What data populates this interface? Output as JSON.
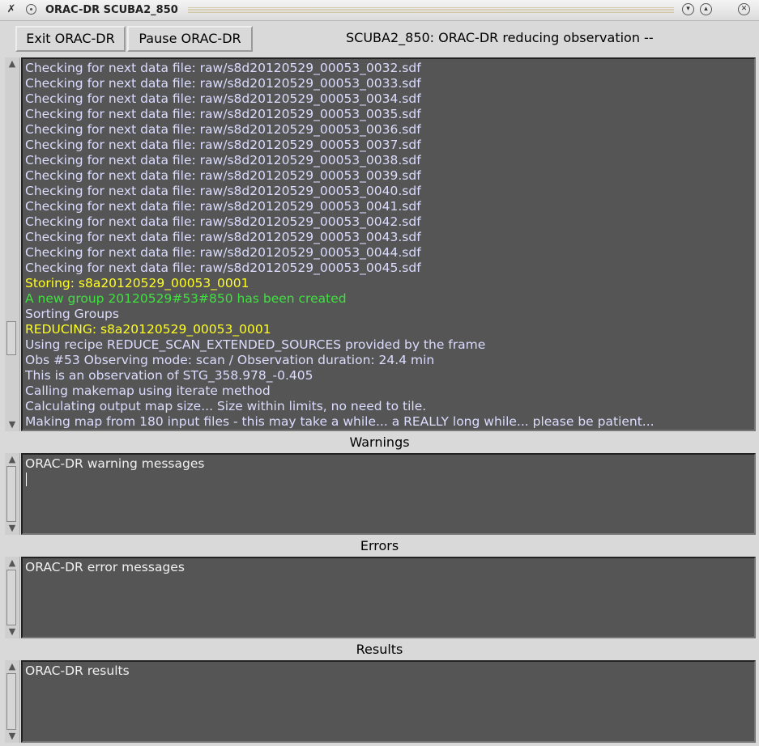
{
  "window": {
    "title": "ORAC-DR SCUBA2_850"
  },
  "toolbar": {
    "exit_label": "Exit ORAC-DR",
    "pause_label": "Pause ORAC-DR",
    "status": "SCUBA2_850: ORAC-DR reducing observation --"
  },
  "log": {
    "lines": [
      {
        "text": "Checking for next data file: raw/s8d20120529_00053_0032.sdf",
        "color": "#dcdcff"
      },
      {
        "text": "Checking for next data file: raw/s8d20120529_00053_0033.sdf",
        "color": "#dcdcff"
      },
      {
        "text": "Checking for next data file: raw/s8d20120529_00053_0034.sdf",
        "color": "#dcdcff"
      },
      {
        "text": "Checking for next data file: raw/s8d20120529_00053_0035.sdf",
        "color": "#dcdcff"
      },
      {
        "text": "Checking for next data file: raw/s8d20120529_00053_0036.sdf",
        "color": "#dcdcff"
      },
      {
        "text": "Checking for next data file: raw/s8d20120529_00053_0037.sdf",
        "color": "#dcdcff"
      },
      {
        "text": "Checking for next data file: raw/s8d20120529_00053_0038.sdf",
        "color": "#dcdcff"
      },
      {
        "text": "Checking for next data file: raw/s8d20120529_00053_0039.sdf",
        "color": "#dcdcff"
      },
      {
        "text": "Checking for next data file: raw/s8d20120529_00053_0040.sdf",
        "color": "#dcdcff"
      },
      {
        "text": "Checking for next data file: raw/s8d20120529_00053_0041.sdf",
        "color": "#dcdcff"
      },
      {
        "text": "Checking for next data file: raw/s8d20120529_00053_0042.sdf",
        "color": "#dcdcff"
      },
      {
        "text": "Checking for next data file: raw/s8d20120529_00053_0043.sdf",
        "color": "#dcdcff"
      },
      {
        "text": "Checking for next data file: raw/s8d20120529_00053_0044.sdf",
        "color": "#dcdcff"
      },
      {
        "text": "Checking for next data file: raw/s8d20120529_00053_0045.sdf",
        "color": "#dcdcff"
      },
      {
        "text": "Storing: s8a20120529_00053_0001",
        "color": "#ffff20"
      },
      {
        "text": "A new group 20120529#53#850 has been created",
        "color": "#40e040"
      },
      {
        "text": "Sorting Groups",
        "color": "#dcdcff"
      },
      {
        "text": "REDUCING: s8a20120529_00053_0001",
        "color": "#ffff20"
      },
      {
        "text": "Using recipe REDUCE_SCAN_EXTENDED_SOURCES provided by the frame",
        "color": "#dcdcff"
      },
      {
        "text": "Obs #53 Observing mode: scan / Observation duration: 24.4 min",
        "color": "#dcdcff"
      },
      {
        "text": "This is an observation of STG_358.978_-0.405",
        "color": "#dcdcff"
      },
      {
        "text": "Calling makemap using iterate method",
        "color": "#dcdcff"
      },
      {
        "text": "Calculating output map size... Size within limits, no need to tile.",
        "color": "#dcdcff"
      },
      {
        "text": "Making map from 180 input files - this may take a while... a REALLY long while... please be patient...",
        "color": "#dcdcff"
      }
    ]
  },
  "warnings": {
    "label": "Warnings",
    "text": "ORAC-DR warning messages"
  },
  "errors": {
    "label": "Errors",
    "text": "ORAC-DR error messages"
  },
  "results": {
    "label": "Results",
    "text": "ORAC-DR results"
  }
}
